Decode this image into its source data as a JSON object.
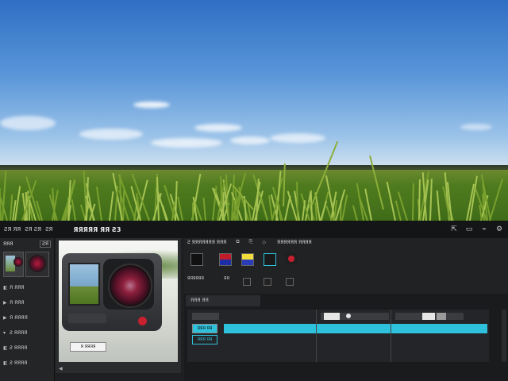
{
  "menu": {
    "items": [
      "ƧЯ ЯЯ",
      "ƧЯ ƧЯ",
      "ƧЯ"
    ],
    "title": "ЯЯЯЯЯ ЯЯ Ƨ3"
  },
  "left_panel": {
    "header": "ЯЯЯ",
    "header_button": "ƧЯ",
    "tree": [
      {
        "icon": "◧",
        "label": "Я ЯЯЯ"
      },
      {
        "icon": "▶",
        "label": "Я ЯЯЯ"
      },
      {
        "icon": "▶",
        "label": "Я ЯЯЯЯ"
      },
      {
        "icon": "▾",
        "label": "Ƨ ЯЯЯЯ"
      },
      {
        "icon": "◧",
        "label": "Ƨ ЯЯЯЯ"
      },
      {
        "icon": "◧",
        "label": "Ƨ ЯЯЯЯ"
      }
    ]
  },
  "viewer": {
    "caption": "Я ЯЯЯЯ",
    "control": "◀"
  },
  "effects": {
    "header": "Ƨ ЯЯЯЯЯЯЯ ЯЯЯ",
    "header_right": "ЯЯЯЯЯЯ ЯЯЯЯ",
    "labels": [
      "ЯЯЯЯЯЯ",
      "ЯЯ"
    ]
  },
  "timeline": {
    "header": "ЯЯЯ ЯЯ",
    "tracks": [
      "ЯЯЯ ЯЯ",
      "ЯЯЯ ЯЯ"
    ]
  },
  "colors": {
    "accent": "#2ec1dc",
    "panel": "#1e1f21",
    "record_red": "#c7202f"
  }
}
